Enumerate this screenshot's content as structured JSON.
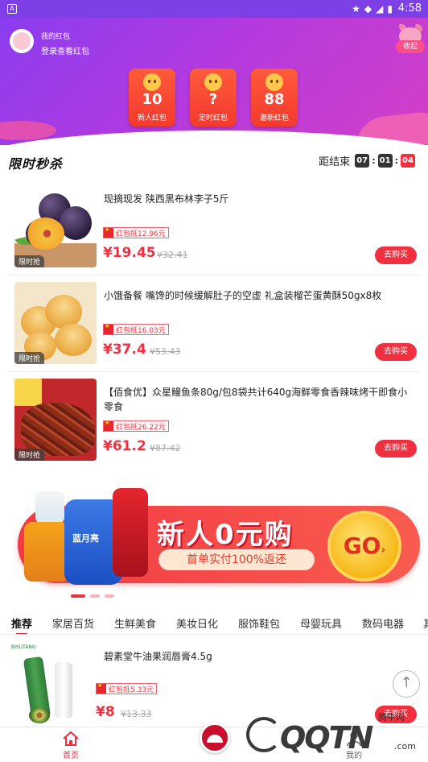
{
  "status_bar": {
    "app_icon": "A",
    "time": "4:58",
    "icons": [
      "star-icon",
      "wifi-icon",
      "signal-icon",
      "battery-icon"
    ]
  },
  "header": {
    "user_title": "我的红包",
    "user_subtitle": "登录查看红包",
    "collapse_label": "收起"
  },
  "red_packets": [
    {
      "value": "10",
      "label": "新人红包"
    },
    {
      "value": "?",
      "label": "定时红包"
    },
    {
      "value": "88",
      "label": "邀新红包"
    }
  ],
  "flash_sale": {
    "title": "限时秒杀",
    "countdown_label": "距结束",
    "hours": "07",
    "minutes": "01",
    "seconds": "04"
  },
  "products": [
    {
      "title": "现摘现发 陕西黑布林李子5斤",
      "coupon": "红包抵12.96元",
      "price": "¥19.45",
      "original_price": "¥32.41",
      "tag": "限时抢",
      "buy_label": "去购买"
    },
    {
      "title": "小饿备餐 嘴馋的时候缓解肚子的空虚 礼盒装榴芒蛋黄酥50gx8枚",
      "coupon": "红包抵16.03元",
      "price": "¥37.4",
      "original_price": "¥53.43",
      "tag": "限时抢",
      "buy_label": "去购买"
    },
    {
      "title": "【佰食优】众星鳗鱼条80g/包8袋共计640g海鲜零食香辣味烤干即食小零食",
      "coupon": "红包抵26.22元",
      "price": "¥61.2",
      "original_price": "¥87.42",
      "tag": "限时抢",
      "buy_label": "去购买"
    }
  ],
  "banner": {
    "title": "新人0元购",
    "subtitle": "首单实付100%返还",
    "go_label": "GO",
    "bottle_label": "蓝月亮"
  },
  "categories": [
    "推荐",
    "家居百货",
    "生鲜美食",
    "美妆日化",
    "服饰鞋包",
    "母婴玩具",
    "数码电器",
    "其"
  ],
  "recommend": [
    {
      "title": "碧素堂牛油果润唇膏4.5g",
      "coupon": "红包抵5.33元",
      "price": "¥8",
      "original_price": "¥13.33",
      "buy_label": "去购买",
      "brand_text": "BISUTANG"
    }
  ],
  "tab_bar": {
    "home_label": "首页",
    "mine_label": "我的"
  },
  "watermark": {
    "main": "QQTN",
    "small": "腾牛网",
    "domain": ".com"
  },
  "colors": {
    "accent": "#f0303f",
    "hero_start": "#8a3df0",
    "hero_end": "#d43fc6",
    "envelope": "#f33a2e"
  }
}
